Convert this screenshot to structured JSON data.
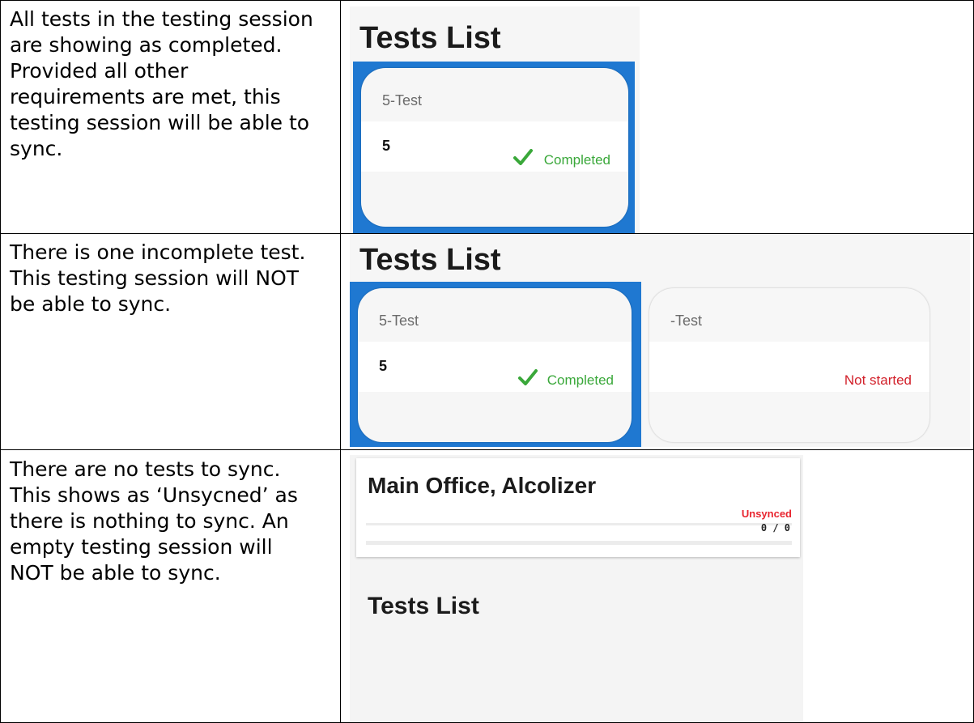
{
  "rows": [
    {
      "description": [
        "All tests in the testing session",
        "are showing as completed.",
        "Provided all other",
        "requirements are met, this",
        "testing session will be able to",
        "sync."
      ],
      "screenshot": {
        "heading": "Tests List",
        "cards": [
          {
            "name": "5-Test",
            "value": "5",
            "status": "Completed",
            "status_kind": "completed"
          }
        ]
      }
    },
    {
      "description": [
        "There is one incomplete test.",
        "This testing session will NOT",
        "be able to sync."
      ],
      "screenshot": {
        "heading": "Tests List",
        "cards": [
          {
            "name": "5-Test",
            "value": "5",
            "status": "Completed",
            "status_kind": "completed"
          },
          {
            "name": "-Test",
            "value": "",
            "status": "Not started",
            "status_kind": "not-started"
          }
        ]
      }
    },
    {
      "description": [
        "There are no tests to sync.",
        "This shows as ‘Unsycned’ as",
        "there is nothing to sync.  An",
        "empty testing session will",
        "NOT be able to sync."
      ],
      "screenshot": {
        "location_title": "Main Office, Alcolizer",
        "sync_status": "Unsynced",
        "sync_count": "0 / 0",
        "heading": "Tests List"
      }
    }
  ],
  "colors": {
    "completed": "#3aa83a",
    "not_started": "#d2202a",
    "unsynced": "#e8252f",
    "selected_frame": "#1f78d1"
  },
  "icons": [
    "checkmark-icon"
  ]
}
